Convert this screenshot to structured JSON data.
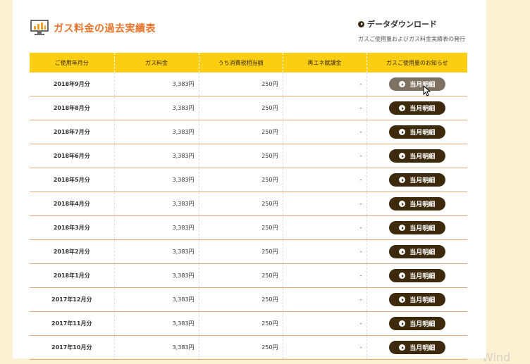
{
  "page": {
    "title": "ガス料金の過去実績表",
    "watermark": "Wind"
  },
  "download": {
    "heading": "データダウンロード",
    "link": "ガスご使用量およびガス料金実績表の発行"
  },
  "table": {
    "headers": [
      "ご使用年月分",
      "ガス料金",
      "うち消費税相当額",
      "再エネ賦課金",
      "ガスご使用量のお知らせ"
    ],
    "rows": [
      {
        "month": "2018年9月分",
        "fee": "3,383円",
        "tax": "250円",
        "renewable": "-",
        "button": "当月明細"
      },
      {
        "month": "2018年8月分",
        "fee": "3,383円",
        "tax": "250円",
        "renewable": "-",
        "button": "当月明細"
      },
      {
        "month": "2018年7月分",
        "fee": "3,383円",
        "tax": "250円",
        "renewable": "-",
        "button": "当月明細"
      },
      {
        "month": "2018年6月分",
        "fee": "3,383円",
        "tax": "250円",
        "renewable": "-",
        "button": "当月明細"
      },
      {
        "month": "2018年5月分",
        "fee": "3,383円",
        "tax": "250円",
        "renewable": "-",
        "button": "当月明細"
      },
      {
        "month": "2018年4月分",
        "fee": "3,383円",
        "tax": "250円",
        "renewable": "-",
        "button": "当月明細"
      },
      {
        "month": "2018年3月分",
        "fee": "3,383円",
        "tax": "250円",
        "renewable": "-",
        "button": "当月明細"
      },
      {
        "month": "2018年2月分",
        "fee": "3,383円",
        "tax": "250円",
        "renewable": "-",
        "button": "当月明細"
      },
      {
        "month": "2018年1月分",
        "fee": "3,383円",
        "tax": "250円",
        "renewable": "-",
        "button": "当月明細"
      },
      {
        "month": "2017年12月分",
        "fee": "3,383円",
        "tax": "250円",
        "renewable": "-",
        "button": "当月明細"
      },
      {
        "month": "2017年11月分",
        "fee": "3,383円",
        "tax": "250円",
        "renewable": "-",
        "button": "当月明細"
      },
      {
        "month": "2017年10月分",
        "fee": "3,383円",
        "tax": "250円",
        "renewable": "-",
        "button": "当月明細"
      }
    ]
  },
  "colors": {
    "accent": "#e8732a",
    "header_bg": "#fcce12",
    "button_bg": "#3d2a0d",
    "button_hover_bg": "#7d7162",
    "page_bg": "#fdf1d3"
  },
  "icons": {
    "title": "chart-monitor-icon",
    "download": "play-circle-icon",
    "button": "play-circle-icon",
    "cursor": "mouse-pointer-icon"
  }
}
